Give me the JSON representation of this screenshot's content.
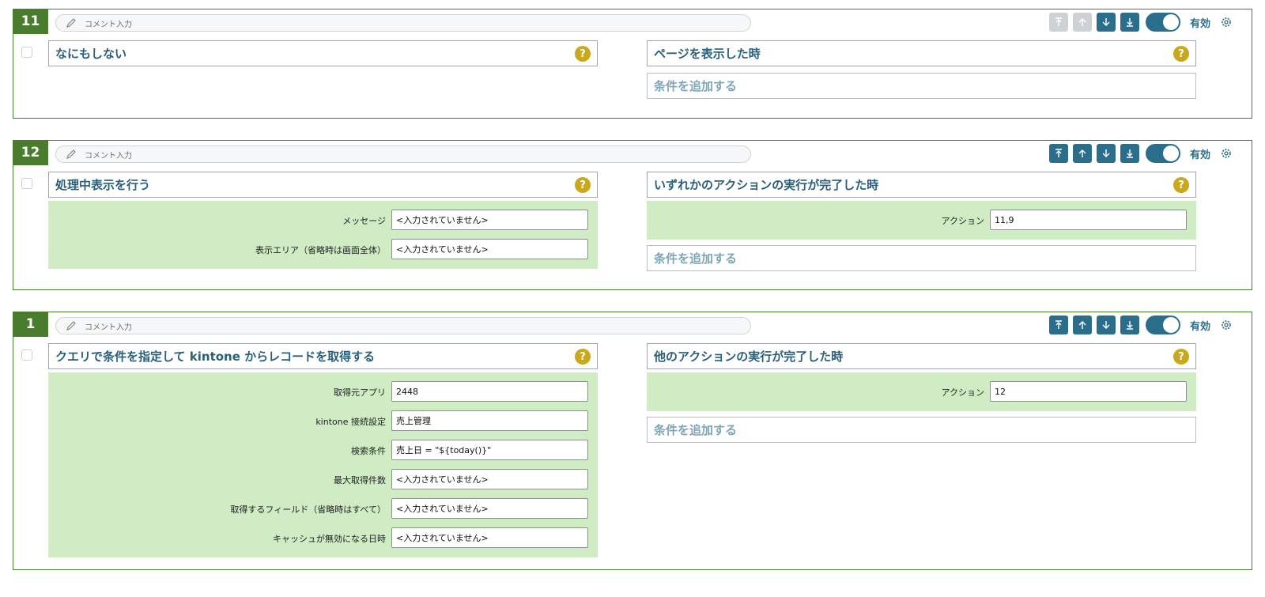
{
  "common": {
    "comment_placeholder": "コメント入力",
    "valid_label": "有効",
    "add_condition": "条件を追加する",
    "help_symbol": "?",
    "accent_color": "#2a6e8c",
    "block_border_color": "#4a7c2e",
    "param_bg_color": "#cfecc4"
  },
  "blocks": [
    {
      "number": "11",
      "move_top_enabled": false,
      "move_up_enabled": false,
      "action_title": "なにもしない",
      "condition_title": "ページを表示した時"
    },
    {
      "number": "12",
      "move_top_enabled": true,
      "move_up_enabled": true,
      "action_title": "処理中表示を行う",
      "action_params": [
        {
          "label": "メッセージ",
          "value": "<入力されていません>"
        },
        {
          "label": "表示エリア（省略時は画面全体）",
          "value": "<入力されていません>"
        }
      ],
      "condition_title": "いずれかのアクションの実行が完了した時",
      "condition_params": [
        {
          "label": "アクション",
          "value": "11,9"
        }
      ]
    },
    {
      "number": "1",
      "move_top_enabled": true,
      "move_up_enabled": true,
      "action_title": "クエリで条件を指定して kintone からレコードを取得する",
      "action_params": [
        {
          "label": "取得元アプリ",
          "value": "2448"
        },
        {
          "label": "kintone 接続設定",
          "value": "売上管理"
        },
        {
          "label": "検索条件",
          "value": "売上日 = \"${today()}\""
        },
        {
          "label": "最大取得件数",
          "value": "<入力されていません>"
        },
        {
          "label": "取得するフィールド（省略時はすべて）",
          "value": "<入力されていません>"
        },
        {
          "label": "キャッシュが無効になる日時",
          "value": "<入力されていません>"
        }
      ],
      "condition_title": "他のアクションの実行が完了した時",
      "condition_params": [
        {
          "label": "アクション",
          "value": "12"
        }
      ]
    }
  ]
}
